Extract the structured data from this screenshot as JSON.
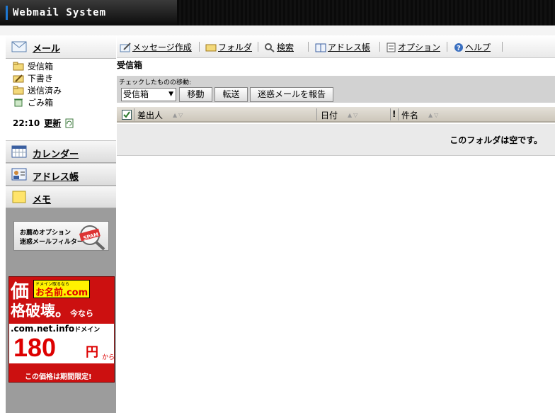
{
  "app": {
    "title": "Webmail System"
  },
  "sidebar": {
    "mail_label": "メール",
    "folders": [
      {
        "label": "受信箱",
        "icon": "inbox-folder-icon"
      },
      {
        "label": "下書き",
        "icon": "drafts-folder-icon"
      },
      {
        "label": "送信済み",
        "icon": "sent-folder-icon"
      },
      {
        "label": "ごみ箱",
        "icon": "trash-icon"
      }
    ],
    "time": "22:10",
    "refresh_label": "更新",
    "calendar_label": "カレンダー",
    "addressbook_label": "アドレス帳",
    "memo_label": "メモ",
    "promo": {
      "line1": "お薦めオプション",
      "line2": "迷惑メールフィルター",
      "badge": "SPAM"
    },
    "ad": {
      "char1": "価",
      "brand_small": "ドメイン取るなら",
      "brand": "お名前.com",
      "line2": "格破壊。",
      "line2_suffix": "今なら",
      "domains": ".com.net.info",
      "domains_suffix": "ドメイン",
      "price": "180",
      "yen": "円",
      "kara": "から",
      "footer": "この価格は期間限定!"
    }
  },
  "toolbar": {
    "compose": "メッセージ作成",
    "folder": "フォルダ",
    "search": "検索",
    "addressbook": "アドレス帳",
    "options": "オプション",
    "help": "ヘルプ"
  },
  "main": {
    "folder_title": "受信箱",
    "move_label": "チェックしたものの移動:",
    "move_select": "受信箱",
    "move_button": "移動",
    "forward_button": "転送",
    "report_spam_button": "迷惑メールを報告",
    "columns": {
      "sender": "差出人",
      "date": "日付",
      "priority": "!",
      "subject": "件名"
    },
    "empty_message": "このフォルダは空です。"
  }
}
